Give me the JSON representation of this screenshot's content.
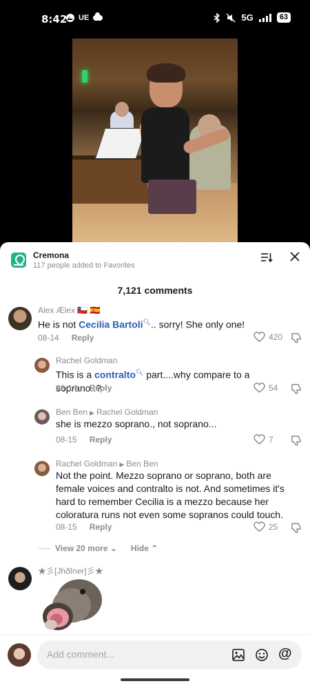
{
  "status": {
    "time": "8:42",
    "carrier_tag": "UE",
    "network": "5G",
    "battery": "63"
  },
  "favorites": {
    "title": "Cremona",
    "subtitle": "117 people added to Favorites"
  },
  "comments_count": "7,121 comments",
  "comments": [
    {
      "user": "Alex Ælex 🇨🇱 🇪🇸",
      "pre": "He is not ",
      "link": "Cecilia Bartoli",
      "post": ".. sorry! She only one!",
      "date": "08-14",
      "reply": "Reply",
      "likes": "420"
    },
    {
      "user": "Rachel Goldman",
      "pre": "This is a ",
      "link": "contralto",
      "post": " part....why compare to a soprano..?",
      "date": "08-14",
      "reply": "Reply",
      "likes": "54"
    },
    {
      "user": "Ben Ben",
      "reply_to": "Rachel Goldman",
      "text": "she is mezzo soprano., not soprano...",
      "date": "08-15",
      "reply": "Reply",
      "likes": "7"
    },
    {
      "user": "Rachel Goldman",
      "reply_to": "Ben Ben",
      "text": "Not the point. Mezzo soprano or soprano, both are female voices and contralto is not. And sometimes it's hard to remember Cecilia is a mezzo because her coloratura runs not even some sopranos could touch.",
      "date": "08-15",
      "reply": "Reply",
      "likes": "25"
    },
    {
      "user": "★彡[Jhðĭner]彡★"
    }
  ],
  "thread": {
    "view_more": "View 20 more",
    "hide": "Hide"
  },
  "composer": {
    "placeholder": "Add comment..."
  },
  "colors": {
    "link": "#2b5db6",
    "accent": "#1fb38a"
  }
}
